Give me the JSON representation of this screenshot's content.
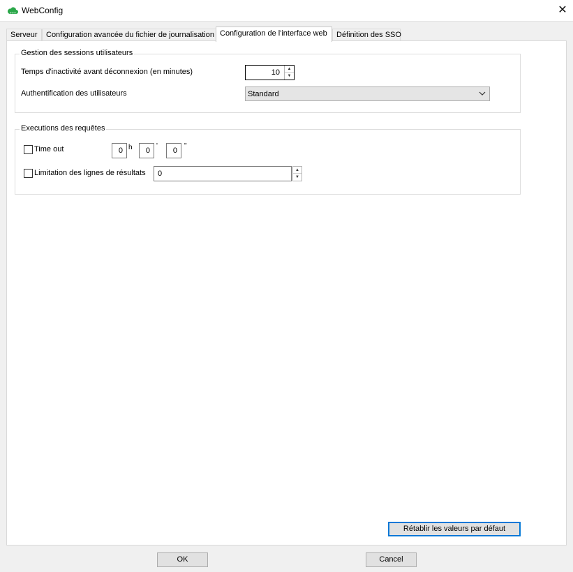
{
  "window": {
    "title": "WebConfig",
    "close_glyph": "✕",
    "icon": "cloud-icon",
    "accent_color": "#2ba84a"
  },
  "tabs": [
    {
      "label": "Serveur"
    },
    {
      "label": "Configuration avancée du fichier de journalisation"
    },
    {
      "label": "Configuration de l'interface web"
    },
    {
      "label": "Définition des SSO"
    }
  ],
  "sessions": {
    "legend": "Gestion des sessions utilisateurs",
    "inactivity_label": "Temps d'inactivité avant déconnexion (en minutes)",
    "inactivity_value": "10",
    "auth_label": "Authentification des utilisateurs",
    "auth_value": "Standard"
  },
  "queries": {
    "legend": "Executions des requêtes",
    "timeout_label": "Time out",
    "timeout_hours": "0",
    "hours_unit": "h",
    "timeout_minutes": "0",
    "minutes_unit": "'",
    "timeout_seconds": "0",
    "seconds_unit": "\"",
    "limit_label": "Limitation des lignes de résultats",
    "limit_value": "0"
  },
  "buttons": {
    "restore_defaults": "Rétablir les valeurs par défaut",
    "ok": "OK",
    "cancel": "Cancel"
  }
}
